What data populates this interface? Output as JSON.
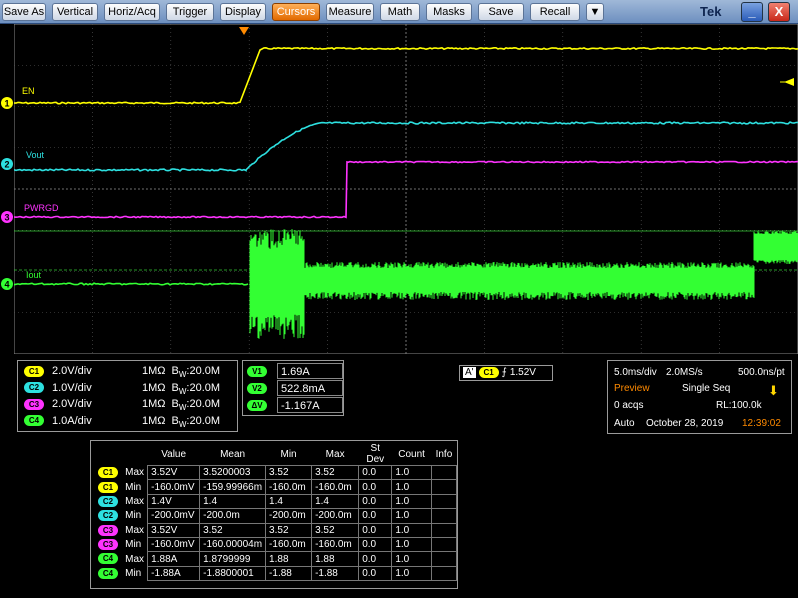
{
  "menu": {
    "items": [
      "Save As",
      "Vertical",
      "Horiz/Acq",
      "Trigger",
      "Display",
      "Cursors",
      "Measure",
      "Math",
      "Masks",
      "Save",
      "Recall",
      "▼"
    ],
    "active": "Cursors"
  },
  "brand": "Tek",
  "window": {
    "minimize": "_",
    "close": "X"
  },
  "colors": {
    "ch1": "#ffff00",
    "ch2": "#2de0e0",
    "ch3": "#ff33ff",
    "ch4": "#33ff33",
    "accent": "#ff8a00"
  },
  "waveforms": {
    "ch1": {
      "label": "EN",
      "marker": "1"
    },
    "ch2": {
      "label": "Vout",
      "marker": "2"
    },
    "ch3": {
      "label": "PWRGD",
      "marker": "3"
    },
    "ch4": {
      "label": "Iout",
      "marker": "4"
    }
  },
  "channels": [
    {
      "badge": "C1",
      "scale": "2.0V/div",
      "impedance": "1MΩ",
      "bw": "B",
      "bw_sub": "W",
      "bw_val": ":20.0M"
    },
    {
      "badge": "C2",
      "scale": "1.0V/div",
      "impedance": "1MΩ",
      "bw": "B",
      "bw_sub": "W",
      "bw_val": ":20.0M"
    },
    {
      "badge": "C3",
      "scale": "2.0V/div",
      "impedance": "1MΩ",
      "bw": "B",
      "bw_sub": "W",
      "bw_val": ":20.0M"
    },
    {
      "badge": "C4",
      "scale": "1.0A/div",
      "impedance": "1MΩ",
      "bw": "B",
      "bw_sub": "W",
      "bw_val": ":20.0M"
    }
  ],
  "cursors": [
    {
      "badge": "V1",
      "value": "1.69A"
    },
    {
      "badge": "V2",
      "value": "522.8mA"
    },
    {
      "badge": "ΔV",
      "value": "-1.167A"
    }
  ],
  "trigger": {
    "mode_badge": "A'",
    "source": "C1",
    "slope": "⨍",
    "level": "1.52V"
  },
  "acquisition": {
    "timebase": "5.0ms/div",
    "sample_rate": "2.0MS/s",
    "resolution": "500.0ns/pt",
    "status": "Preview",
    "seq_mode": "Single Seq",
    "acqs": "0 acqs",
    "record_length": "RL:100.0k",
    "run_mode": "Auto",
    "date": "October 28, 2019",
    "time": "12:39:02"
  },
  "measurements": {
    "headers": [
      "",
      "",
      "Value",
      "Mean",
      "Min",
      "Max",
      "St Dev",
      "Count",
      "Info"
    ],
    "rows": [
      {
        "ch": "C1",
        "stat": "Max",
        "cells": [
          "3.52V",
          "3.5200003",
          "3.52",
          "3.52",
          "0.0",
          "1.0",
          ""
        ]
      },
      {
        "ch": "C1",
        "stat": "Min",
        "cells": [
          "-160.0mV",
          "-159.99966m",
          "-160.0m",
          "-160.0m",
          "0.0",
          "1.0",
          ""
        ]
      },
      {
        "ch": "C2",
        "stat": "Max",
        "cells": [
          "1.4V",
          "1.4",
          "1.4",
          "1.4",
          "0.0",
          "1.0",
          ""
        ]
      },
      {
        "ch": "C2",
        "stat": "Min",
        "cells": [
          "-200.0mV",
          "-200.0m",
          "-200.0m",
          "-200.0m",
          "0.0",
          "1.0",
          ""
        ]
      },
      {
        "ch": "C3",
        "stat": "Max",
        "cells": [
          "3.52V",
          "3.52",
          "3.52",
          "3.52",
          "0.0",
          "1.0",
          ""
        ]
      },
      {
        "ch": "C3",
        "stat": "Min",
        "cells": [
          "-160.0mV",
          "-160.00004m",
          "-160.0m",
          "-160.0m",
          "0.0",
          "1.0",
          ""
        ]
      },
      {
        "ch": "C4",
        "stat": "Max",
        "cells": [
          "1.88A",
          "1.8799999",
          "1.88",
          "1.88",
          "0.0",
          "1.0",
          ""
        ]
      },
      {
        "ch": "C4",
        "stat": "Min",
        "cells": [
          "-1.88A",
          "-1.8800001",
          "-1.88",
          "-1.88",
          "0.0",
          "1.0",
          ""
        ]
      }
    ]
  }
}
